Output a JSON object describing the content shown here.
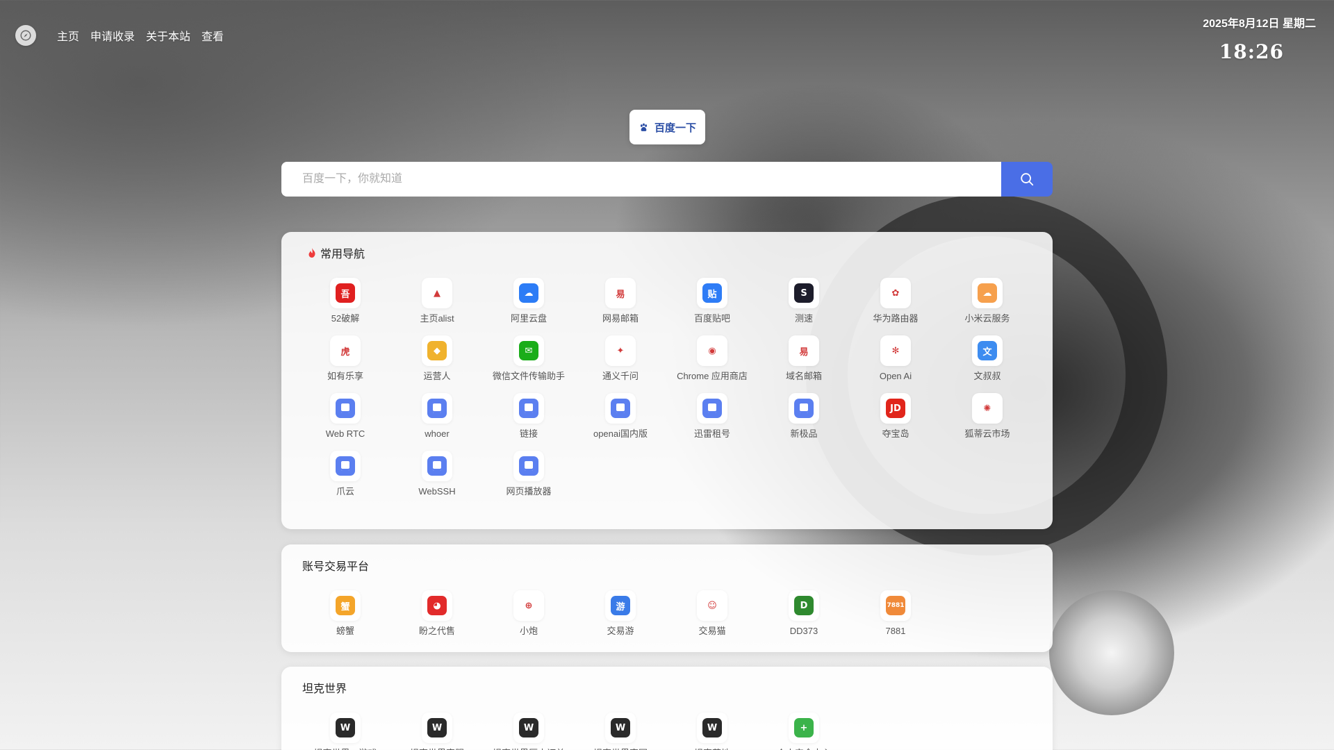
{
  "nav": {
    "logo_icon": "compass-icon",
    "links": [
      "主页",
      "申请收录",
      "关于本站",
      "查看"
    ]
  },
  "clock": {
    "date": "2025年8月12日 星期二",
    "time": "18:26"
  },
  "search": {
    "engine_label": "百度一下",
    "engine_icon": "baidu-paw-icon",
    "placeholder": "百度一下，你就知道",
    "value": "",
    "button_icon": "search-icon",
    "accent": "#4a6ee6"
  },
  "sections": {
    "common": {
      "title": "常用导航",
      "title_icon": "fire-icon",
      "items": [
        {
          "label": "52破解",
          "icon": "52pojie-icon",
          "color": "#e02020",
          "glyph": "吾"
        },
        {
          "label": "主页alist",
          "icon": "alist-icon",
          "color": "#ffffff",
          "glyph": "▲"
        },
        {
          "label": "阿里云盘",
          "icon": "aliyun-drive-icon",
          "color": "#2c7cf6",
          "glyph": "☁"
        },
        {
          "label": "网易邮箱",
          "icon": "netease-mail-icon",
          "color": "#ffffff",
          "glyph": "易"
        },
        {
          "label": "百度贴吧",
          "icon": "tieba-icon",
          "color": "#2e7cf6",
          "glyph": "贴"
        },
        {
          "label": "测速",
          "icon": "speedtest-icon",
          "color": "#1d1d2b",
          "glyph": "S"
        },
        {
          "label": "华为路由器",
          "icon": "huawei-icon",
          "color": "#ffffff",
          "glyph": "✿"
        },
        {
          "label": "小米云服务",
          "icon": "xiaomi-cloud-icon",
          "color": "#f6a04d",
          "glyph": "☁"
        },
        {
          "label": "如有乐享",
          "icon": "tiger-icon",
          "color": "#ffffff",
          "glyph": "虎"
        },
        {
          "label": "运营人",
          "icon": "yunyingren-icon",
          "color": "#f0b22d",
          "glyph": "◆"
        },
        {
          "label": "微信文件传输助手",
          "icon": "wechat-icon",
          "color": "#1aad19",
          "glyph": "✉"
        },
        {
          "label": "通义千问",
          "icon": "tongyi-icon",
          "color": "#ffffff",
          "glyph": "✦"
        },
        {
          "label": "Chrome 应用商店",
          "icon": "chrome-icon",
          "color": "#ffffff",
          "glyph": "◉"
        },
        {
          "label": "域名邮箱",
          "icon": "domain-mail-icon",
          "color": "#ffffff",
          "glyph": "易"
        },
        {
          "label": "Open Ai",
          "icon": "openai-icon",
          "color": "#ffffff",
          "glyph": "✻"
        },
        {
          "label": "文叔叔",
          "icon": "wenshushu-icon",
          "color": "#3d8cf0",
          "glyph": "文"
        },
        {
          "label": "Web RTC",
          "icon": "doc-icon",
          "color": "#5b7ff0",
          "glyph": ""
        },
        {
          "label": "whoer",
          "icon": "doc-icon",
          "color": "#5b7ff0",
          "glyph": ""
        },
        {
          "label": "链接",
          "icon": "doc-icon",
          "color": "#5b7ff0",
          "glyph": ""
        },
        {
          "label": "openai国内版",
          "icon": "doc-icon",
          "color": "#5b7ff0",
          "glyph": ""
        },
        {
          "label": "迅雷租号",
          "icon": "doc-icon",
          "color": "#5b7ff0",
          "glyph": ""
        },
        {
          "label": "新极品",
          "icon": "doc-icon",
          "color": "#5b7ff0",
          "glyph": ""
        },
        {
          "label": "夺宝岛",
          "icon": "jd-icon",
          "color": "#e1251b",
          "glyph": "JD"
        },
        {
          "label": "狐蒂云市场",
          "icon": "hudiyun-icon",
          "color": "#ffffff",
          "glyph": "✺"
        },
        {
          "label": "爪云",
          "icon": "doc-icon",
          "color": "#5b7ff0",
          "glyph": ""
        },
        {
          "label": "WebSSH",
          "icon": "doc-icon",
          "color": "#5b7ff0",
          "glyph": ""
        },
        {
          "label": "网页播放器",
          "icon": "doc-icon",
          "color": "#5b7ff0",
          "glyph": ""
        }
      ]
    },
    "trade": {
      "title": "账号交易平台",
      "items": [
        {
          "label": "螃蟹",
          "icon": "crab-icon",
          "color": "#f4a52a",
          "glyph": "蟹"
        },
        {
          "label": "盼之代售",
          "icon": "panzhi-icon",
          "color": "#e22b2b",
          "glyph": "◕"
        },
        {
          "label": "小炮",
          "icon": "xiaopao-icon",
          "color": "#ffffff",
          "glyph": "⊕"
        },
        {
          "label": "交易游",
          "icon": "jiaoyiyou-icon",
          "color": "#3a7be8",
          "glyph": "游"
        },
        {
          "label": "交易猫",
          "icon": "jiaoyimao-icon",
          "color": "#ffffff",
          "glyph": "☺"
        },
        {
          "label": "DD373",
          "icon": "dd373-icon",
          "color": "#2f8a2f",
          "glyph": "D"
        },
        {
          "label": "7881",
          "icon": "7881-icon",
          "color": "#f08a3a",
          "glyph": "7881"
        }
      ]
    },
    "tank": {
      "title": "坦克世界",
      "items": [
        {
          "label": "坦克世界二游戏",
          "icon": "wot-shield-icon",
          "color": "#2a2a2a",
          "glyph": "W"
        },
        {
          "label": "坦克世界官服",
          "icon": "wot-shield-icon",
          "color": "#2a2a2a",
          "glyph": "W"
        },
        {
          "label": "坦克世界历史订单",
          "icon": "wot-shield-icon",
          "color": "#2a2a2a",
          "glyph": "W"
        },
        {
          "label": "坦克世界官网",
          "icon": "wot-shield-icon",
          "color": "#2a2a2a",
          "glyph": "W"
        },
        {
          "label": "坦克营地",
          "icon": "wot-shield-icon",
          "color": "#2a2a2a",
          "glyph": "W"
        },
        {
          "label": "个人安全中心",
          "icon": "security-center-icon",
          "color": "#3bb34a",
          "glyph": "+"
        }
      ]
    }
  }
}
